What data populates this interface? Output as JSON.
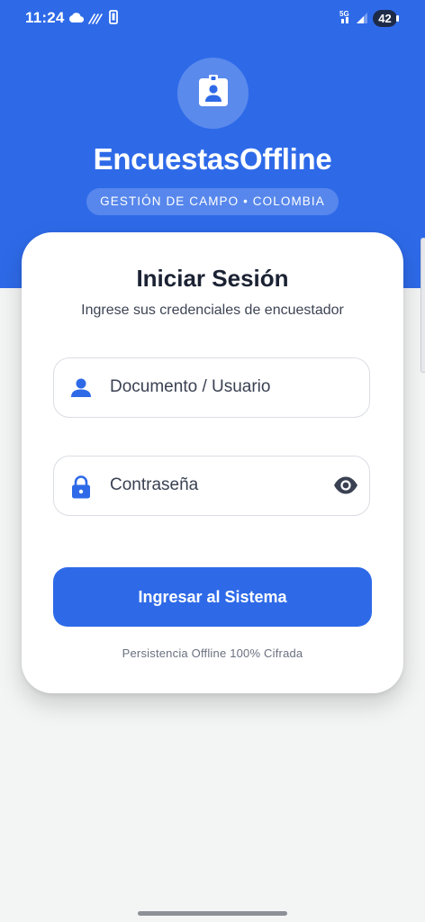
{
  "status_bar": {
    "time": "11:24",
    "network": "5G",
    "battery": "42",
    "icons": [
      "cloud-icon",
      "data-sync-icon",
      "vibrate-icon",
      "network-5g-icon",
      "signal-icon",
      "battery-icon"
    ]
  },
  "header": {
    "logo_icon": "badge-icon",
    "title": "EncuestasOffline",
    "subtitle": "GESTIÓN DE CAMPO • COLOMBIA"
  },
  "login": {
    "title": "Iniciar Sesión",
    "subtitle": "Ingrese sus credenciales de encuestador",
    "username": {
      "placeholder": "Documento / Usuario",
      "value": "",
      "icon": "person-icon"
    },
    "password": {
      "placeholder": "Contraseña",
      "value": "",
      "icon": "lock-icon",
      "toggle_icon": "eye-icon"
    },
    "submit_label": "Ingresar al Sistema",
    "footer_note": "Persistencia Offline 100% Cifrada"
  },
  "colors": {
    "primary": "#2e6ae8",
    "background": "#f3f4f4",
    "card": "#ffffff",
    "text_dark": "#1b2233"
  }
}
